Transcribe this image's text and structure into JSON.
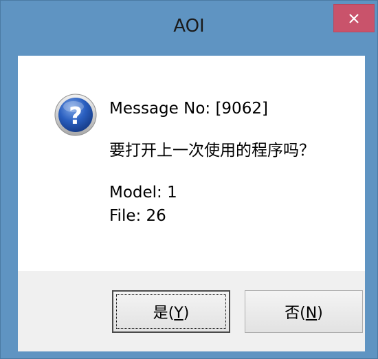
{
  "window": {
    "title": "AOI"
  },
  "titlebar": {
    "close_icon": "close-icon"
  },
  "message": {
    "icon": "question-icon",
    "icon_glyph": "?",
    "message_no": "Message No: [9062]",
    "question": "要打开上一次使用的程序吗？",
    "model": "Model: 1",
    "file": "File: 26"
  },
  "buttons": {
    "yes_label": "是",
    "yes_mnemonic_prefix": "(",
    "yes_mnemonic": "Y",
    "yes_mnemonic_suffix": ")",
    "no_label": "否",
    "no_mnemonic_prefix": "(",
    "no_mnemonic": "N",
    "no_mnemonic_suffix": ")"
  },
  "colors": {
    "titlebar": "#5f94c2",
    "close_button": "#c9536b",
    "content_bg": "#ffffff",
    "button_area_bg": "#f0f0f0",
    "icon_blue": "#1f4fa8"
  }
}
